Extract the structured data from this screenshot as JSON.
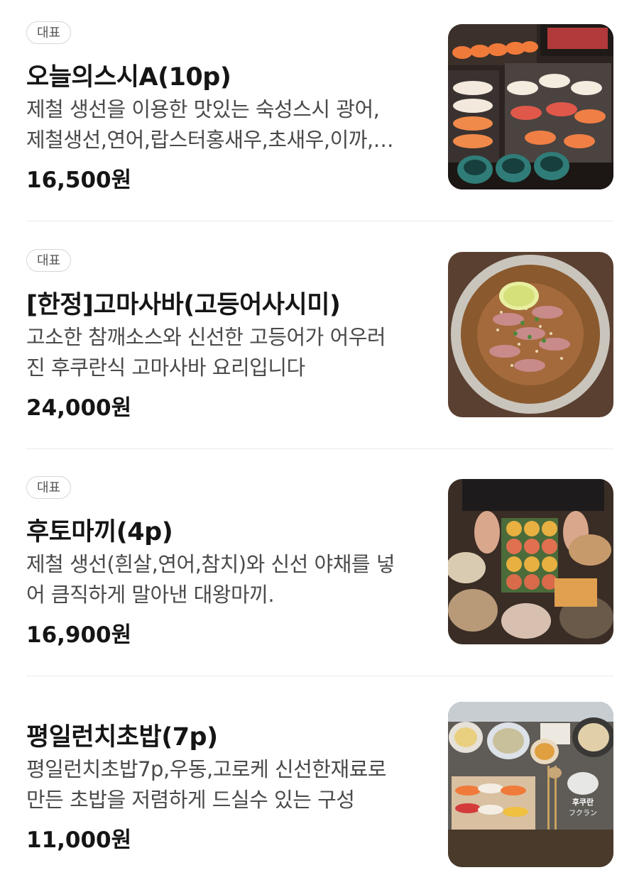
{
  "menu": {
    "items": [
      {
        "badge": "대표",
        "name": "오늘의스시A(10p)",
        "desc_line1": "제철 생선을 이용한 맛있는 숙성스시 광어,",
        "desc_line2": "제철생선,연어,랍스터홍새우,초새우,이까,…",
        "price": "16,500원",
        "image": "sushi-platter-photo"
      },
      {
        "badge": "대표",
        "name": "[한정]고마사바(고등어사시미)",
        "desc_line1": "고소한 참깨소스와 신선한 고등어가 어우러",
        "desc_line2": "진 후쿠란식 고마사바 요리입니다",
        "price": "24,000원",
        "image": "mackerel-sesame-dish-photo"
      },
      {
        "badge": "대표",
        "name": "후토마끼(4p)",
        "desc_line1": "제철 생선(흰살,연어,참치)와 신선 야채를 넣",
        "desc_line2": "어 큼직하게 말아낸 대왕마끼.",
        "price": "16,900원",
        "image": "futomaki-roll-photo"
      },
      {
        "name": "평일런치초밥(7p)",
        "desc_line1": "평일런치초밥7p,우동,고로케 신선한재료로",
        "desc_line2": "만든 초밥을 저렴하게 드실수 있는 구성",
        "price": "11,000원",
        "image": "weekday-lunch-set-photo",
        "logo_text_1": "후쿠란",
        "logo_text_2": "フクラン"
      }
    ]
  }
}
